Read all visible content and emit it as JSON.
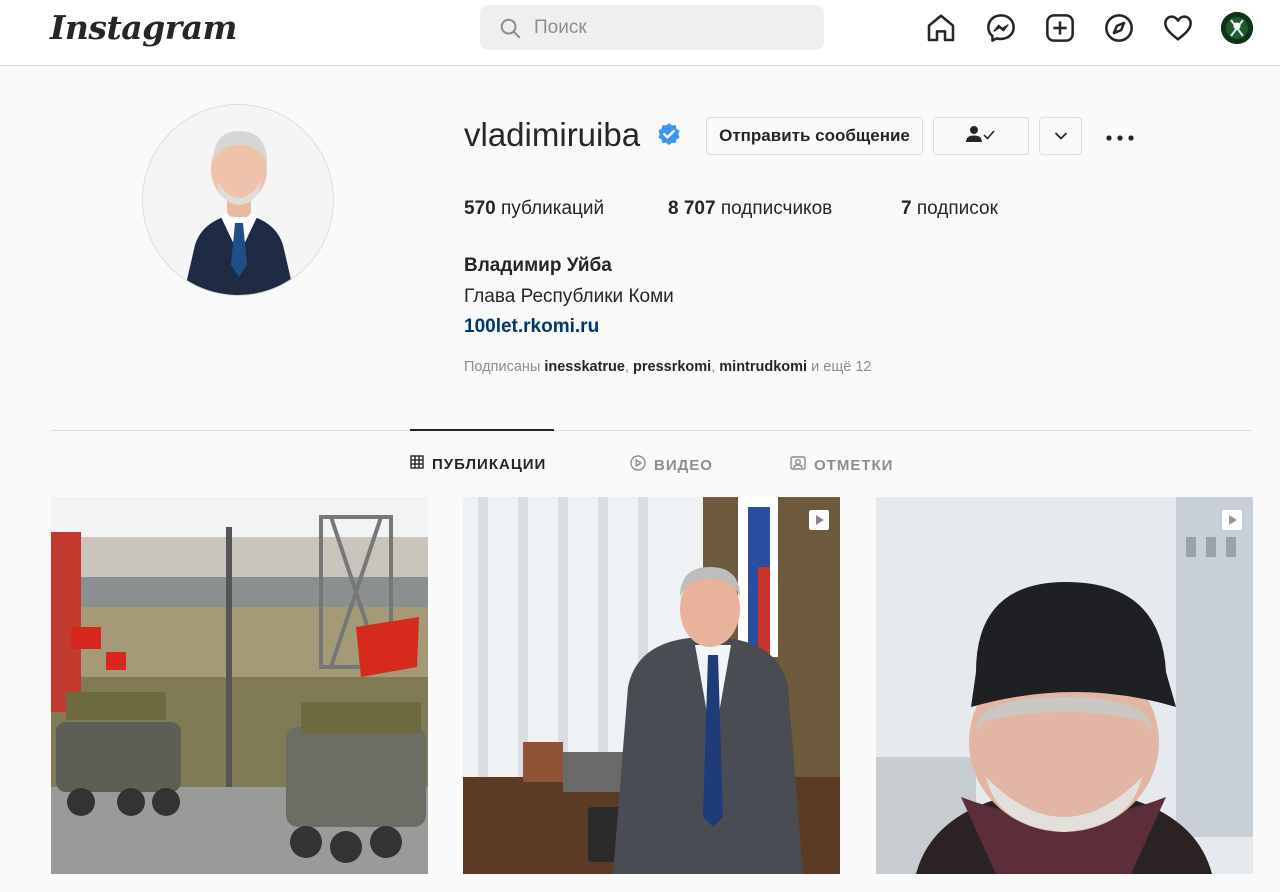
{
  "app": {
    "logo": "Instagram"
  },
  "search": {
    "placeholder": "Поиск"
  },
  "nav": {
    "icons": [
      "home-icon",
      "messenger-icon",
      "new-post-icon",
      "explore-icon",
      "activity-icon",
      "profile-avatar"
    ]
  },
  "profile": {
    "username": "vladimiruiba",
    "verified": true,
    "message_button": "Отправить сообщение",
    "full_name": "Владимир Уйба",
    "bio": "Глава Республики Коми",
    "website": "100let.rkomi.ru",
    "stats": {
      "posts_count": "570",
      "posts_label": "публикаций",
      "followers_count": "8 707",
      "followers_label": "подписчиков",
      "following_count": "7",
      "following_label": "подписок"
    },
    "followed_by": {
      "prefix": "Подписаны",
      "users": [
        "inesskatrue",
        "pressrkomi",
        "mintrudkomi"
      ],
      "suffix": "и ещё 12"
    }
  },
  "tabs": [
    {
      "label": "ПУБЛИКАЦИИ",
      "icon": "grid-icon",
      "active": true
    },
    {
      "label": "ВИДЕО",
      "icon": "video-icon",
      "active": false
    },
    {
      "label": "ОТМЕТКИ",
      "icon": "tagged-icon",
      "active": false
    }
  ],
  "posts": [
    {
      "kind": "image"
    },
    {
      "kind": "video"
    },
    {
      "kind": "video"
    }
  ],
  "colors": {
    "link": "#00376b",
    "verified": "#3897f0",
    "border": "#dbdbdb",
    "muted": "#8e8e8e"
  }
}
